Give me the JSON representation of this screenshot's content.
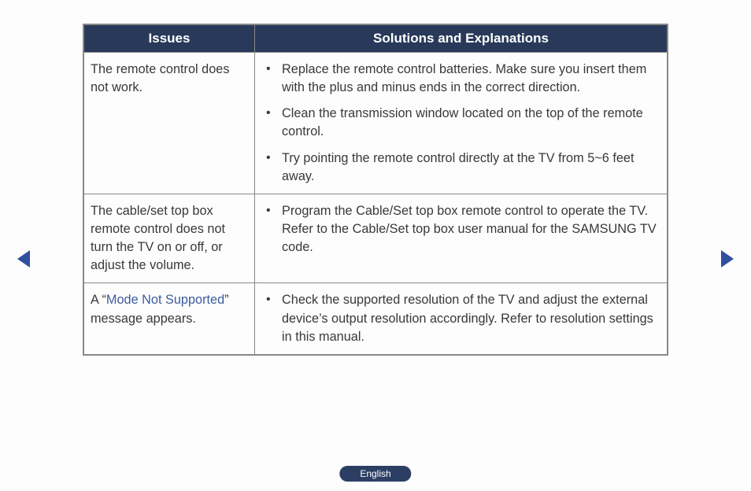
{
  "headers": {
    "col1": "Issues",
    "col2": "Solutions and Explanations"
  },
  "rows": [
    {
      "issue": "The remote control does not work.",
      "solutions": [
        "Replace the remote control batteries. Make sure you insert them with the plus and minus ends in the correct direction.",
        "Clean the transmission window located on the top of the remote control.",
        "Try pointing the remote control directly at the TV from 5~6 feet away."
      ]
    },
    {
      "issue": "The cable/set top box remote control does not turn the TV on or off, or adjust the volume.",
      "solutions": [
        "Program the Cable/Set top box remote control to operate the TV. Refer to the Cable/Set top box user manual for the SAMSUNG TV code."
      ]
    },
    {
      "issue_pre": "A “",
      "issue_colored": "Mode Not Supported",
      "issue_post": "” message appears.",
      "solutions": [
        "Check the supported resolution of the TV and adjust the external device’s output resolution accordingly. Refer to resolution settings in this manual."
      ]
    }
  ],
  "language_label": "English"
}
